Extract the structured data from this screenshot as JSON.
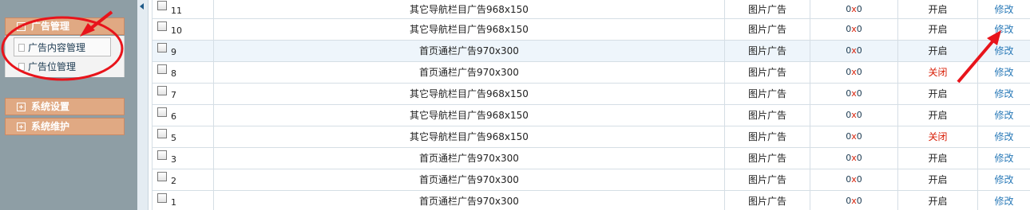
{
  "sidebar": {
    "ad_group": {
      "label": "广告管理",
      "items": [
        {
          "label": "广告内容管理"
        },
        {
          "label": "广告位管理"
        }
      ]
    },
    "system_settings": {
      "label": "系统设置"
    },
    "system_maintenance": {
      "label": "系统维护"
    }
  },
  "table": {
    "rows": [
      {
        "id": "11",
        "name": "其它导航栏目广告968x150",
        "type": "图片广告",
        "clicks": "0",
        "status": "开启",
        "action": "修改"
      },
      {
        "id": "10",
        "name": "其它导航栏目广告968x150",
        "type": "图片广告",
        "clicks": "0",
        "status": "开启",
        "action": "修改"
      },
      {
        "id": "9",
        "name": "首页通栏广告970x300",
        "type": "图片广告",
        "clicks": "0",
        "status": "开启",
        "action": "修改"
      },
      {
        "id": "8",
        "name": "首页通栏广告970x300",
        "type": "图片广告",
        "clicks": "0",
        "status": "关闭",
        "action": "修改"
      },
      {
        "id": "7",
        "name": "其它导航栏目广告968x150",
        "type": "图片广告",
        "clicks": "0",
        "status": "开启",
        "action": "修改"
      },
      {
        "id": "6",
        "name": "其它导航栏目广告968x150",
        "type": "图片广告",
        "clicks": "0",
        "status": "开启",
        "action": "修改"
      },
      {
        "id": "5",
        "name": "其它导航栏目广告968x150",
        "type": "图片广告",
        "clicks": "0",
        "status": "关闭",
        "action": "修改"
      },
      {
        "id": "3",
        "name": "首页通栏广告970x300",
        "type": "图片广告",
        "clicks": "0",
        "status": "开启",
        "action": "修改"
      },
      {
        "id": "2",
        "name": "首页通栏广告970x300",
        "type": "图片广告",
        "clicks": "0",
        "status": "开启",
        "action": "修改"
      },
      {
        "id": "1",
        "name": "首页通栏广告970x300",
        "type": "图片广告",
        "clicks": "0",
        "status": "开启",
        "action": "修改"
      }
    ]
  },
  "colors": {
    "sidebar_bg": "#8e9ea5",
    "menu_head": "#e0a983",
    "link": "#2a7ab8",
    "closed_status": "#d81e06",
    "annotation_red": "#e8141b"
  }
}
